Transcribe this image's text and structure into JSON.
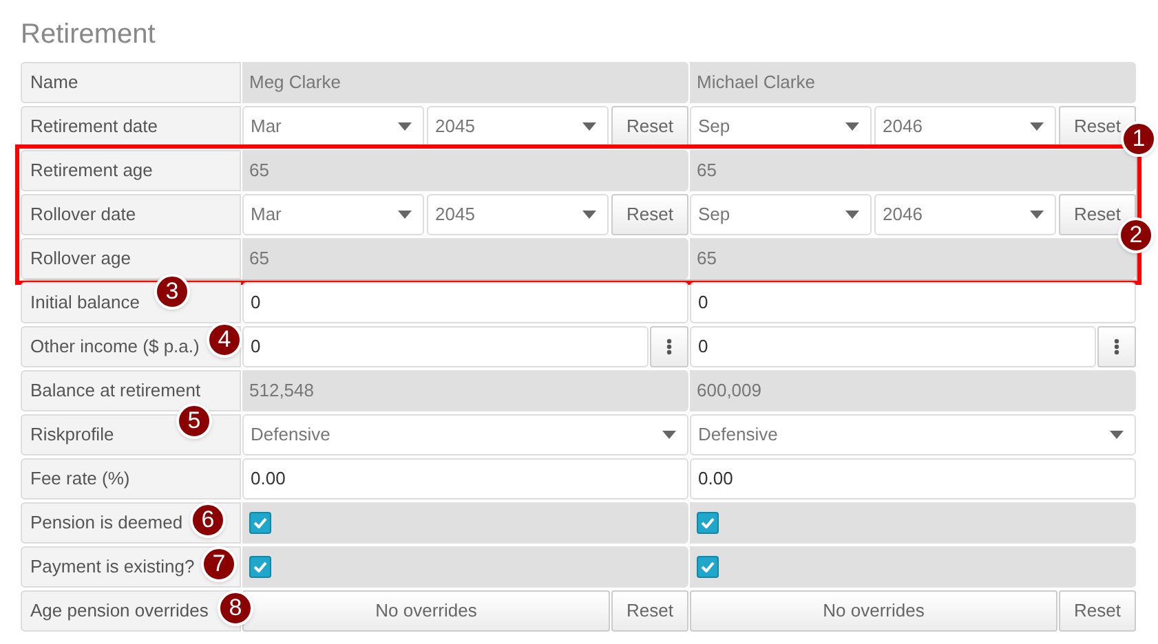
{
  "title": "Retirement",
  "rows": [
    {
      "label": "Name",
      "kind": "readonly",
      "highlighted": false,
      "cells": [
        {
          "value": "Meg Clarke"
        },
        {
          "value": "Michael Clarke"
        }
      ]
    },
    {
      "label": "Retirement date",
      "kind": "date",
      "highlighted": false,
      "cells": [
        {
          "month": "Mar",
          "year": "2045",
          "reset": "Reset"
        },
        {
          "month": "Sep",
          "year": "2046",
          "reset": "Reset"
        }
      ]
    },
    {
      "label": "Retirement age",
      "kind": "readonly",
      "highlighted": true,
      "cells": [
        {
          "value": "65"
        },
        {
          "value": "65"
        }
      ]
    },
    {
      "label": "Rollover date",
      "kind": "date",
      "highlighted": true,
      "cells": [
        {
          "month": "Mar",
          "year": "2045",
          "reset": "Reset"
        },
        {
          "month": "Sep",
          "year": "2046",
          "reset": "Reset"
        }
      ]
    },
    {
      "label": "Rollover age",
      "kind": "readonly",
      "highlighted": true,
      "cells": [
        {
          "value": "65"
        },
        {
          "value": "65"
        }
      ]
    },
    {
      "label": "Initial balance",
      "kind": "input",
      "highlighted": false,
      "cells": [
        {
          "value": "0"
        },
        {
          "value": "0"
        }
      ]
    },
    {
      "label": "Other income ($ p.a.)",
      "kind": "input_menu",
      "highlighted": false,
      "cells": [
        {
          "value": "0"
        },
        {
          "value": "0"
        }
      ]
    },
    {
      "label": "Balance at retirement",
      "kind": "readonly",
      "highlighted": false,
      "cells": [
        {
          "value": "512,548"
        },
        {
          "value": "600,009"
        }
      ]
    },
    {
      "label": "Riskprofile",
      "kind": "select",
      "highlighted": false,
      "cells": [
        {
          "value": "Defensive"
        },
        {
          "value": "Defensive"
        }
      ]
    },
    {
      "label": "Fee rate (%)",
      "kind": "input",
      "highlighted": false,
      "cells": [
        {
          "value": "0.00"
        },
        {
          "value": "0.00"
        }
      ]
    },
    {
      "label": "Pension is deemed",
      "kind": "checkbox",
      "highlighted": false,
      "cells": [
        {
          "checked": true
        },
        {
          "checked": true
        }
      ]
    },
    {
      "label": "Payment is existing?",
      "kind": "checkbox",
      "highlighted": false,
      "cells": [
        {
          "checked": true
        },
        {
          "checked": true
        }
      ]
    },
    {
      "label": "Age pension overrides",
      "kind": "overrides",
      "highlighted": false,
      "cells": [
        {
          "text": "No overrides",
          "reset": "Reset"
        },
        {
          "text": "No overrides",
          "reset": "Reset"
        }
      ]
    }
  ],
  "markers": [
    {
      "label": "1"
    },
    {
      "label": "2"
    },
    {
      "label": "3"
    },
    {
      "label": "4"
    },
    {
      "label": "5"
    },
    {
      "label": "6"
    },
    {
      "label": "7"
    },
    {
      "label": "8"
    }
  ]
}
